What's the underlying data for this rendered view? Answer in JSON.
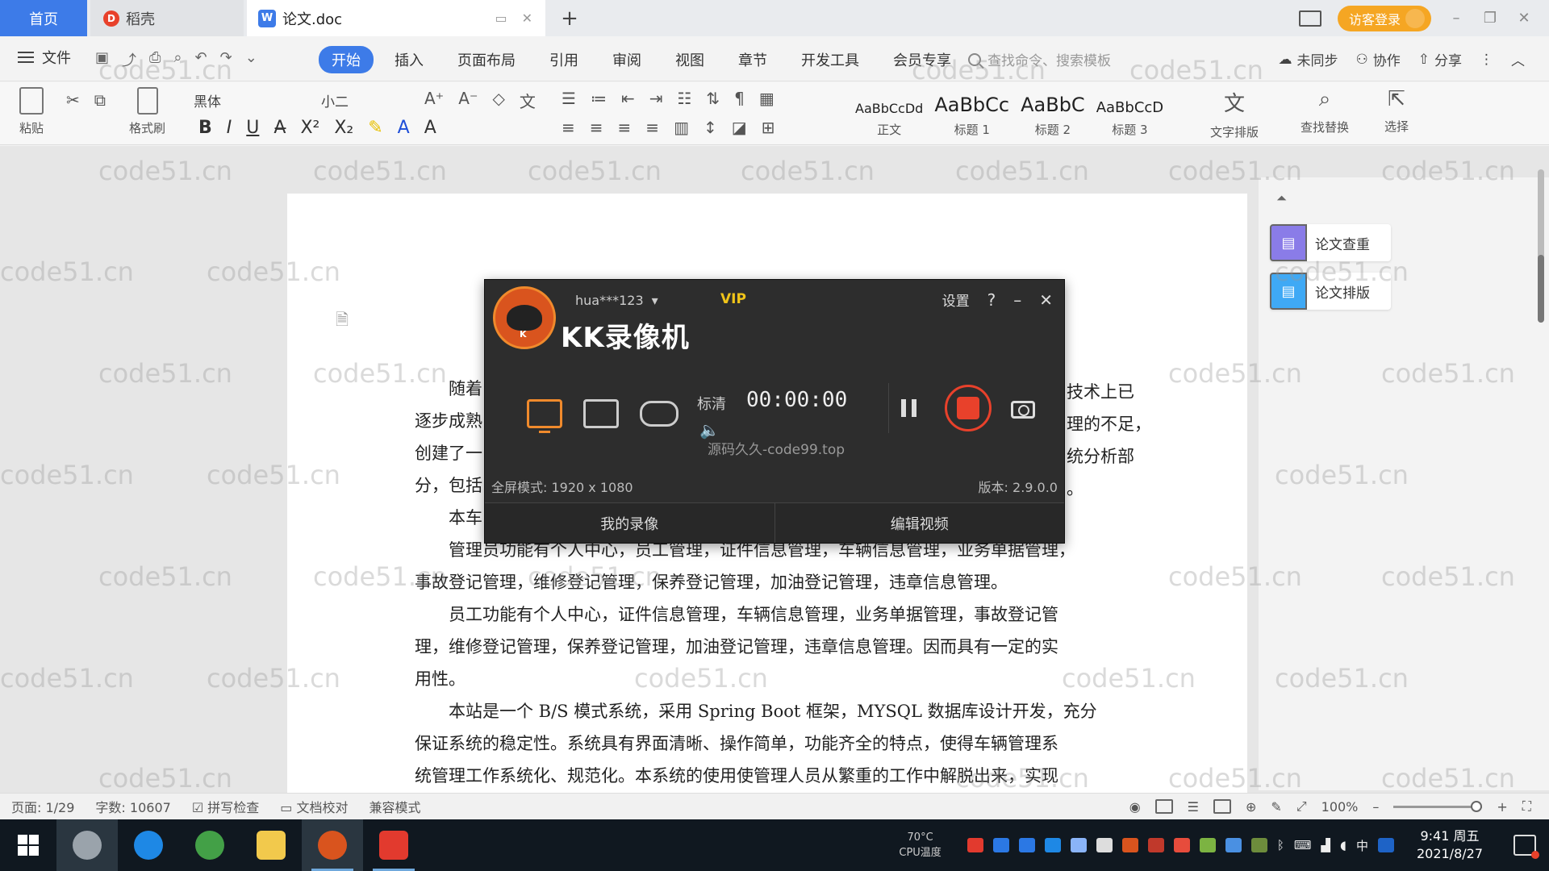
{
  "tabs": {
    "home": "首页",
    "daoke": "稻壳",
    "doc": "论文.doc",
    "new_tab": "+"
  },
  "titlebar": {
    "login": "访客登录"
  },
  "menu": {
    "file": "文件",
    "tabs": [
      "开始",
      "插入",
      "页面布局",
      "引用",
      "审阅",
      "视图",
      "章节",
      "开发工具",
      "会员专享"
    ],
    "search_placeholder": "查找命令、搜索模板",
    "unsynced": "未同步",
    "collab": "协作",
    "share": "分享"
  },
  "ribbon": {
    "paste": "粘贴",
    "format_painter": "格式刷",
    "font_name": "黑体",
    "font_size": "小二",
    "styles": [
      {
        "preview": "AaBbCcDd",
        "label": "正文"
      },
      {
        "preview": "AaBbCc",
        "label": "标题 1"
      },
      {
        "preview": "AaBbC",
        "label": "标题 2"
      },
      {
        "preview": "AaBbCcD",
        "label": "标题 3"
      }
    ],
    "text_tools": "文字排版",
    "find_replace": "查找替换",
    "select": "选择"
  },
  "side_panel": {
    "btn1": "论文查重",
    "btn2": "论文排版"
  },
  "document": {
    "paragraphs": [
      "随着",
      "逐步成熟",
      "创建了一",
      "分，包括",
      "本车",
      "管理员功能有个人中心，员工管理，证件信息管理，车辆信息管理，业务单据管理，",
      "事故登记管理，维修登记管理，保养登记管理，加油登记管理，违章信息管理。",
      "员工功能有个人中心，证件信息管理，车辆信息管理，业务单据管理，事故登记管",
      "理，维修登记管理，保养登记管理，加油登记管理，违章信息管理。因而具有一定的实",
      "用性。",
      "本站是一个 B/S 模式系统，采用 Spring Boot 框架，MYSQL 数据库设计开发，充分",
      "保证系统的稳定性。系统具有界面清晰、操作简单，功能齐全的特点，使得车辆管理系",
      "统管理工作系统化、规范化。本系统的使用使管理人员从繁重的工作中解脱出来，实现"
    ],
    "right_fragments": [
      "技术上已",
      "理的不足，",
      "统分析部",
      "。"
    ]
  },
  "watermark": "code51.cn",
  "kk": {
    "user": "hua***123",
    "vip": "VIP",
    "title": "KK录像机",
    "settings": "设置",
    "help": "?",
    "minimize": "–",
    "close": "✕",
    "quality": "标清",
    "timer": "00:00:00",
    "overlay_site": "源码久久-code99.top",
    "fullscreen_mode": "全屏模式: 1920 x 1080",
    "version": "版本: 2.9.0.0",
    "my_recordings": "我的录像",
    "edit_video": "编辑视频"
  },
  "statusbar": {
    "page": "页面: 1/29",
    "word_count": "字数: 10607",
    "spell_check": "拼写检查",
    "doc_proof": "文档校对",
    "compat_mode": "兼容模式",
    "zoom": "100%",
    "zoom_minus": "–",
    "zoom_plus": "+"
  },
  "taskbar": {
    "cpu_temp": "70°C",
    "cpu_label": "CPU温度",
    "ime": "中",
    "time": "9:41 周五",
    "date": "2021/8/27"
  },
  "colors": {
    "accent": "#3d7be8",
    "login": "#f5a623",
    "record": "#e8412b",
    "kk_bg": "#2d2d2d"
  }
}
